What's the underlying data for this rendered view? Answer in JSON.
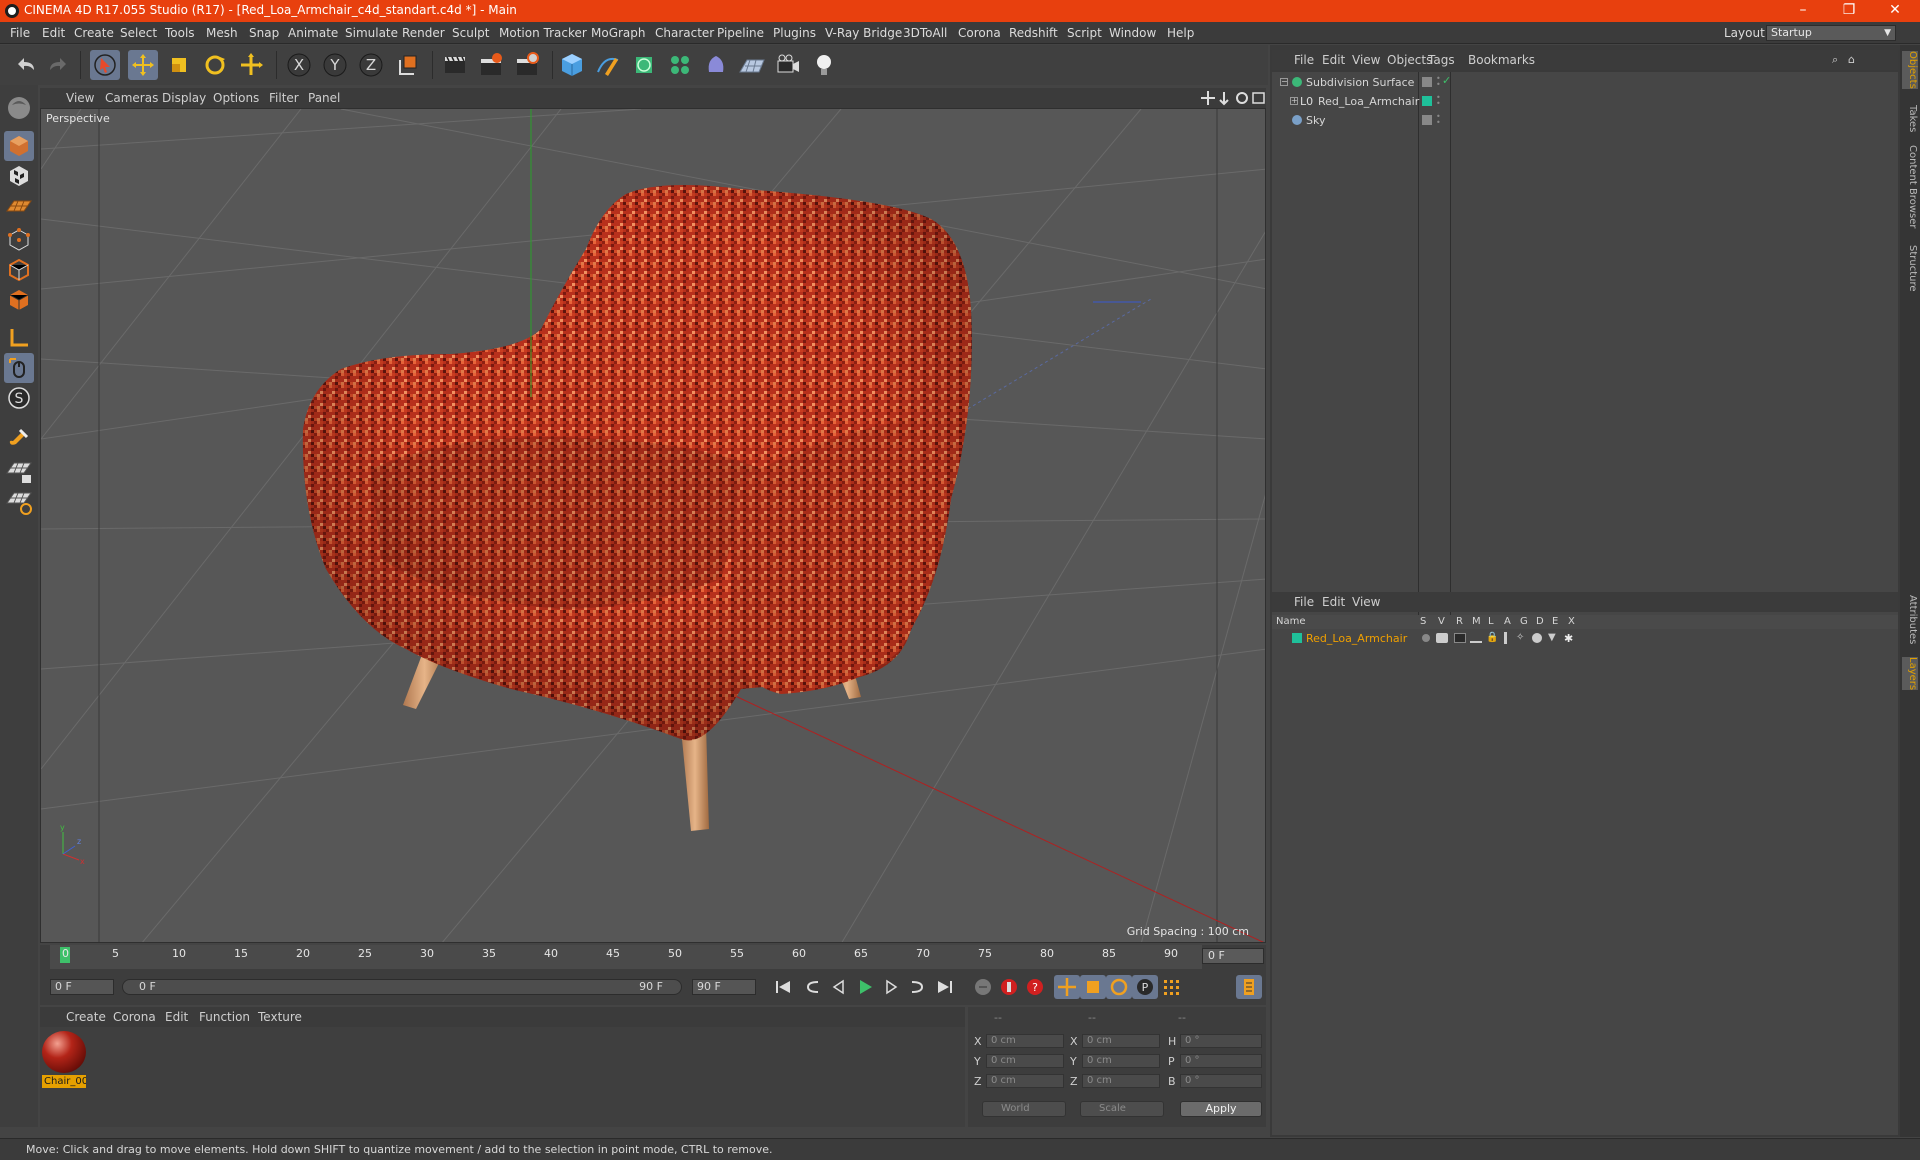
{
  "window": {
    "title": "CINEMA 4D R17.055 Studio (R17) - [Red_Loa_Armchair_c4d_standart.c4d *] - Main",
    "buttons": {
      "minimize": "–",
      "restore": "❐",
      "close": "✕"
    }
  },
  "menu": [
    "File",
    "Edit",
    "Create",
    "Select",
    "Tools",
    "Mesh",
    "Snap",
    "Animate",
    "Simulate",
    "Render",
    "Sculpt",
    "Motion Tracker",
    "MoGraph",
    "Character",
    "Pipeline",
    "Plugins",
    "V-Ray Bridge",
    "3DToAll",
    "Corona",
    "Redshift",
    "Script",
    "Window",
    "Help"
  ],
  "layout": {
    "label": "Layout:",
    "value": "Startup"
  },
  "viewport": {
    "menu": [
      "View",
      "Cameras",
      "Display",
      "Options",
      "Filter",
      "Panel"
    ],
    "label": "Perspective",
    "grid_spacing": "Grid Spacing : 100 cm"
  },
  "timeline": {
    "ticks": [
      "0",
      "5",
      "10",
      "15",
      "20",
      "25",
      "30",
      "35",
      "40",
      "45",
      "50",
      "55",
      "60",
      "65",
      "70",
      "75",
      "80",
      "85",
      "90"
    ],
    "current_frame": "0 F",
    "start_field": "0 F",
    "range_start": "0 F",
    "range_end": "90 F",
    "end_field": "90 F"
  },
  "material_manager": {
    "menu": [
      "Create",
      "Corona",
      "Edit",
      "Function",
      "Texture"
    ],
    "materials": [
      {
        "name": "Chair_00"
      }
    ]
  },
  "coordinates": {
    "header": [
      "--",
      "--",
      "--"
    ],
    "rows": [
      {
        "l1": "X",
        "v1": "0 cm",
        "l2": "X",
        "v2": "0 cm",
        "l3": "H",
        "v3": "0 °"
      },
      {
        "l1": "Y",
        "v1": "0 cm",
        "l2": "Y",
        "v2": "0 cm",
        "l3": "P",
        "v3": "0 °"
      },
      {
        "l1": "Z",
        "v1": "0 cm",
        "l2": "Z",
        "v2": "0 cm",
        "l3": "B",
        "v3": "0 °"
      }
    ],
    "space": "World",
    "mode": "Scale",
    "apply": "Apply"
  },
  "object_manager": {
    "menu": [
      "File",
      "Edit",
      "View",
      "Objects",
      "Tags",
      "Bookmarks"
    ],
    "objects": [
      {
        "name": "Subdivision Surface"
      },
      {
        "name": "Red_Loa_Armchair"
      },
      {
        "name": "Sky"
      }
    ]
  },
  "layer_manager": {
    "menu": [
      "File",
      "Edit",
      "View"
    ],
    "columns": [
      "Name",
      "S",
      "V",
      "R",
      "M",
      "L",
      "A",
      "G",
      "D",
      "E",
      "X"
    ],
    "layers": [
      {
        "name": "Red_Loa_Armchair",
        "color": "#1fc09a"
      }
    ]
  },
  "right_tabs": [
    "Objects",
    "Takes",
    "Content Browser",
    "Structure",
    "Attributes",
    "Layers"
  ],
  "status": "Move: Click and drag to move elements. Hold down SHIFT to quantize movement / add to the selection in point mode, CTRL to remove.",
  "colors": {
    "accent": "#e8400e",
    "selected_tool": "#6a7891",
    "chair_fabric": "#c0321c",
    "chair_legs": "#d9a273",
    "material_label": "#e6a000",
    "layer_name": "#f0a000"
  },
  "logo": "MAXON CINEMA 4D"
}
